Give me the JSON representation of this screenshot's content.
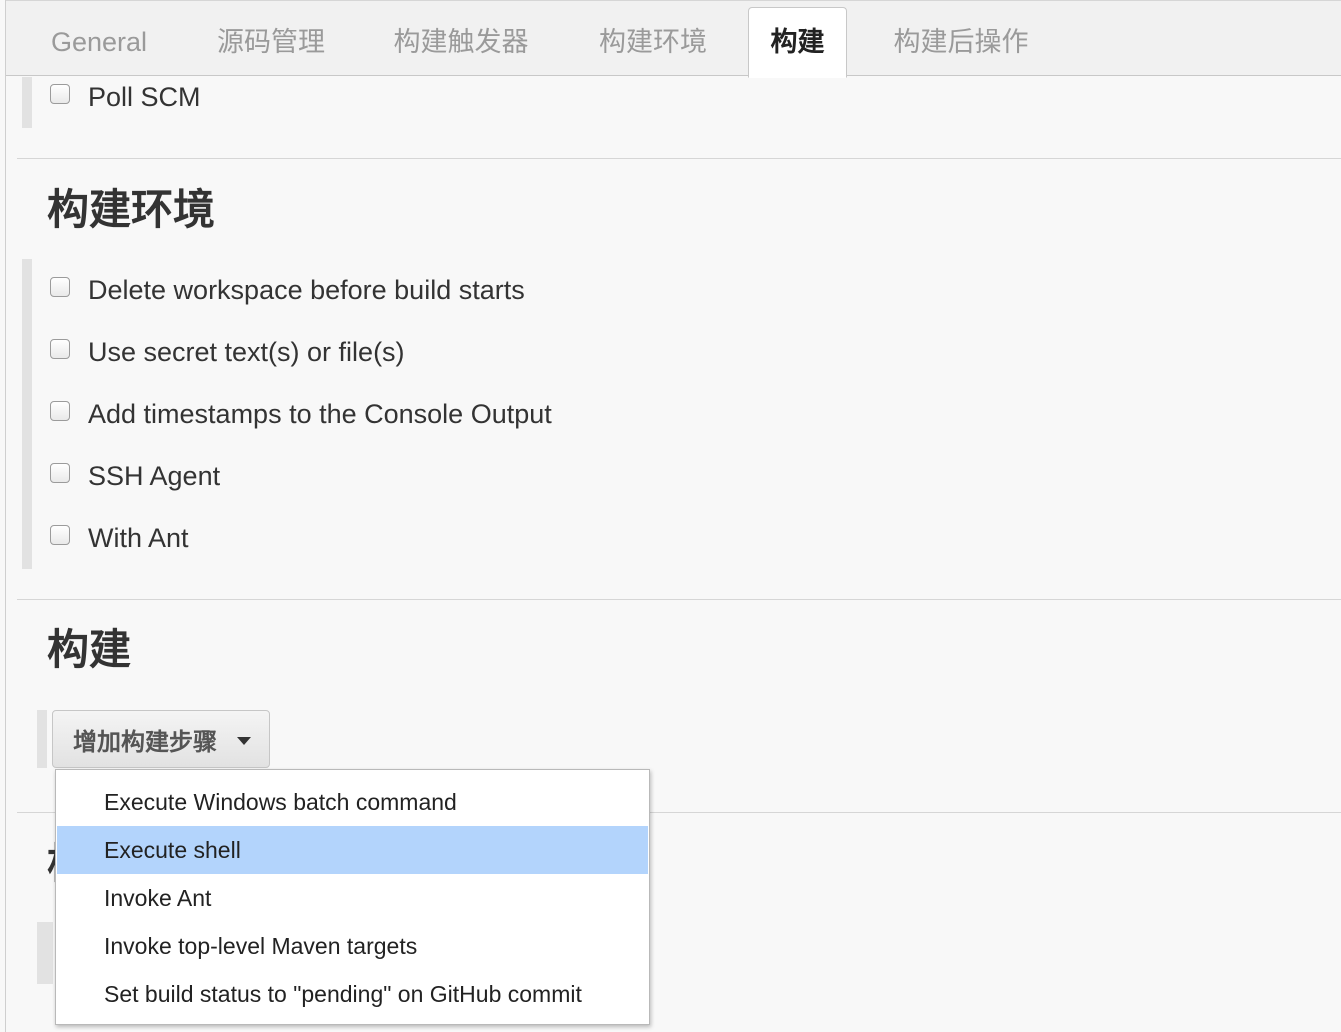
{
  "tabs": [
    {
      "label": "General",
      "active": false
    },
    {
      "label": "源码管理",
      "active": false
    },
    {
      "label": "构建触发器",
      "active": false
    },
    {
      "label": "构建环境",
      "active": false
    },
    {
      "label": "构建",
      "active": true
    },
    {
      "label": "构建后操作",
      "active": false
    }
  ],
  "triggers": {
    "poll_scm": {
      "label": "Poll SCM",
      "checked": false
    }
  },
  "build_env": {
    "title": "构建环境",
    "options": [
      {
        "label": "Delete workspace before build starts",
        "checked": false
      },
      {
        "label": "Use secret text(s) or file(s)",
        "checked": false
      },
      {
        "label": "Add timestamps to the Console Output",
        "checked": false
      },
      {
        "label": "SSH Agent",
        "checked": false
      },
      {
        "label": "With Ant",
        "checked": false
      }
    ]
  },
  "build": {
    "title": "构建",
    "add_step_label": "增加构建步骤",
    "menu": {
      "selected_index": 1,
      "items": [
        "Execute Windows batch command",
        "Execute shell",
        "Invoke Ant",
        "Invoke top-level Maven targets",
        "Set build status to \"pending\" on GitHub commit"
      ]
    }
  },
  "post_build": {
    "title": "构建后操作"
  }
}
